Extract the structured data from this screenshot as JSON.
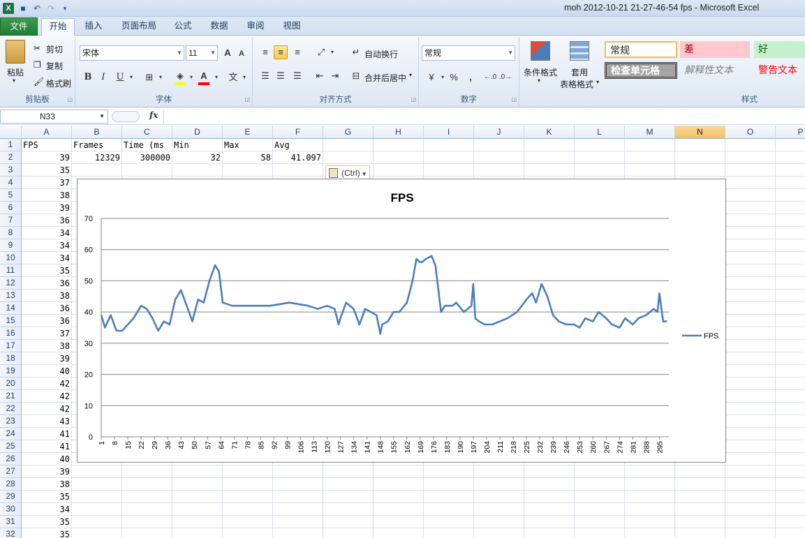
{
  "window": {
    "title": "moh 2012-10-21 21-27-46-54 fps  -  Microsoft Excel"
  },
  "quick_access": {
    "app_icon": "excel-icon",
    "save_icon": "save-icon",
    "undo_icon": "undo-icon",
    "redo_icon": "redo-icon"
  },
  "tabs": [
    "文件",
    "开始",
    "插入",
    "页面布局",
    "公式",
    "数据",
    "审阅",
    "视图"
  ],
  "ribbon": {
    "clipboard": {
      "paste": "粘贴",
      "cut": "剪切",
      "copy": "复制",
      "format_painter": "格式刷",
      "label": "剪贴板"
    },
    "font": {
      "font_name": "宋体",
      "font_size": "11",
      "grow": "A",
      "shrink": "A",
      "bold": "B",
      "italic": "I",
      "underline": "U",
      "label": "字体",
      "fill_color": "#ffff00",
      "font_color": "#ff0000"
    },
    "alignment": {
      "wrap_text": "自动换行",
      "merge_center": "合并后居中",
      "label": "对齐方式"
    },
    "number": {
      "format": "常规",
      "percent": "%",
      "comma": ",",
      "label": "数字"
    },
    "styles_cmds": {
      "conditional": "条件格式",
      "table_format_1": "套用",
      "table_format_2": "表格格式"
    },
    "styles": {
      "normal": "常规",
      "bad": "差",
      "good": "好",
      "check_cell": "检查单元格",
      "explanatory": "解释性文本",
      "warning": "警告文本",
      "label": "样式"
    }
  },
  "formula_bar": {
    "name_box": "N33",
    "fx": "fx",
    "formula": ""
  },
  "columns": [
    "A",
    "B",
    "C",
    "D",
    "E",
    "F",
    "G",
    "H",
    "I",
    "J",
    "K",
    "L",
    "M",
    "N",
    "O",
    "P"
  ],
  "selected_column": "N",
  "rows": {
    "numbers": [
      "1",
      "2",
      "3",
      "4",
      "5",
      "6",
      "7",
      "8",
      "9",
      "10",
      "11",
      "12",
      "13",
      "14",
      "15",
      "16",
      "17",
      "18",
      "19",
      "20",
      "21",
      "22",
      "23",
      "24",
      "25",
      "26",
      "27",
      "28",
      "29",
      "30",
      "31",
      "32"
    ],
    "header_row": [
      "FPS",
      "Frames",
      "Time (ms",
      "Min",
      "Max",
      "Avg"
    ],
    "row2": [
      "39",
      "12329",
      "300000",
      "32",
      "58",
      "41.097"
    ],
    "col_a_values": [
      "35",
      "37",
      "38",
      "39",
      "36",
      "34",
      "34",
      "34",
      "35",
      "36",
      "38",
      "36",
      "36",
      "37",
      "38",
      "39",
      "40",
      "42",
      "42",
      "42",
      "43",
      "41",
      "41",
      "40",
      "39",
      "38",
      "35",
      "34",
      "35",
      "35"
    ]
  },
  "paste_options": {
    "label": "(Ctrl)",
    "icon": "clipboard-icon"
  },
  "chart_data": {
    "type": "line",
    "title": "FPS",
    "xlabel": "",
    "ylabel": "",
    "ylim": [
      0,
      70
    ],
    "yticks": [
      "0",
      "10",
      "20",
      "30",
      "40",
      "50",
      "60",
      "70"
    ],
    "grid": true,
    "legend_position": "right",
    "series": [
      {
        "name": "FPS",
        "color": "#4a7ebb",
        "x": [
          1,
          3,
          6,
          9,
          12,
          15,
          18,
          22,
          25,
          28,
          31,
          34,
          37,
          40,
          43,
          46,
          49,
          52,
          55,
          58,
          61,
          63,
          65,
          70,
          80,
          90,
          100,
          110,
          115,
          120,
          124,
          126,
          127,
          130,
          134,
          137,
          140,
          143,
          146,
          148,
          149,
          152,
          155,
          158,
          162,
          165,
          167,
          169,
          170,
          172,
          175,
          177,
          180,
          182,
          184,
          186,
          188,
          192,
          196,
          197,
          198,
          200,
          203,
          207,
          211,
          215,
          220,
          225,
          228,
          230,
          233,
          236,
          239,
          242,
          246,
          250,
          253,
          256,
          260,
          263,
          267,
          270,
          274,
          277,
          281,
          284,
          288,
          292,
          294,
          295,
          297,
          299
        ],
        "values": [
          39,
          35,
          39,
          34,
          34,
          36,
          38,
          42,
          41,
          38,
          34,
          37,
          36,
          44,
          47,
          42,
          37,
          44,
          43,
          50,
          55,
          53,
          43,
          42,
          42,
          42,
          43,
          42,
          41,
          42,
          41,
          36,
          38,
          43,
          41,
          36,
          41,
          40,
          39,
          33,
          36,
          37,
          40,
          40,
          43,
          50,
          57,
          56,
          56,
          57,
          58,
          55,
          40,
          42,
          42,
          42,
          43,
          40,
          42,
          49,
          38,
          37,
          36,
          36,
          37,
          38,
          40,
          44,
          46,
          43,
          49,
          45,
          39,
          37,
          36,
          36,
          35,
          38,
          37,
          40,
          38,
          36,
          35,
          38,
          36,
          38,
          39,
          41,
          40,
          46,
          37,
          37
        ]
      }
    ],
    "x_tick_labels": [
      "1",
      "8",
      "15",
      "22",
      "29",
      "36",
      "43",
      "50",
      "57",
      "64",
      "71",
      "78",
      "85",
      "92",
      "99",
      "106",
      "113",
      "120",
      "127",
      "134",
      "141",
      "148",
      "155",
      "162",
      "169",
      "176",
      "183",
      "190",
      "197",
      "204",
      "211",
      "218",
      "225",
      "232",
      "239",
      "246",
      "253",
      "260",
      "267",
      "274",
      "281",
      "288",
      "295"
    ]
  }
}
